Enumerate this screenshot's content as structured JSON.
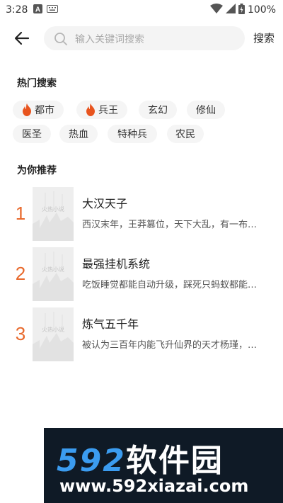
{
  "status_bar": {
    "time": "3:28",
    "battery": "100%"
  },
  "search": {
    "placeholder": "输入关键词搜索",
    "button": "搜索"
  },
  "hot": {
    "title": "热门搜索",
    "tags": [
      "都市",
      "兵王",
      "玄幻",
      "修仙",
      "医圣",
      "热血",
      "特种兵",
      "农民"
    ]
  },
  "recommend": {
    "title": "为你推荐",
    "cover_text": "火热小说",
    "items": [
      {
        "rank": "1",
        "title": "大汉天子",
        "desc": "西汉末年，王莽篡位，天下大乱，有一布…"
      },
      {
        "rank": "2",
        "title": "最强挂机系统",
        "desc": "吃饭睡觉都能自动升级，踩死只蚂蚁都能…"
      },
      {
        "rank": "3",
        "title": "炼气五千年",
        "desc": "被认为三百年内能飞升仙界的天才杨瑾，…"
      }
    ]
  },
  "watermark": {
    "brand_num": "592",
    "brand_text": "软件园",
    "url": "www.592xiazai.com"
  },
  "colors": {
    "accent": "#e8692c",
    "fire": "#e8541e",
    "tag_bg": "#f5f5f5"
  }
}
